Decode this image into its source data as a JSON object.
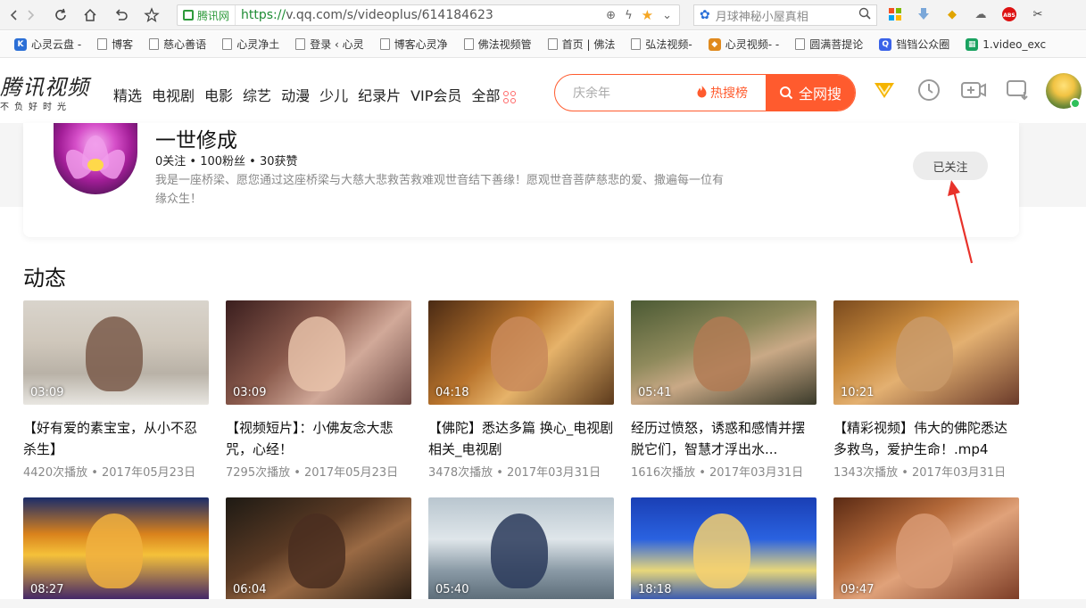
{
  "browser": {
    "site_badge": "腾讯网",
    "url_proto": "https://",
    "url_rest": "v.qq.com/s/videoplus/614184623",
    "side_search_text": "月球神秘小屋真相",
    "bookmarks": [
      {
        "label": "心灵云盘 -",
        "type": "fav",
        "color": "#2b6fd6",
        "glyph": "K"
      },
      {
        "label": "博客",
        "type": "doc"
      },
      {
        "label": "慈心善语",
        "type": "doc"
      },
      {
        "label": "心灵净土",
        "type": "doc"
      },
      {
        "label": "登录 ‹ 心灵",
        "type": "doc"
      },
      {
        "label": "博客心灵净",
        "type": "doc"
      },
      {
        "label": "佛法视频管",
        "type": "doc"
      },
      {
        "label": "首页 | 佛法",
        "type": "doc"
      },
      {
        "label": "弘法视频-",
        "type": "doc"
      },
      {
        "label": "心灵视频- -",
        "type": "fav",
        "color": "#e08a1e",
        "glyph": "◆"
      },
      {
        "label": "圆满菩提论",
        "type": "doc"
      },
      {
        "label": "铛铛公众圈",
        "type": "fav",
        "color": "#3a62e8",
        "glyph": "Q"
      },
      {
        "label": "1.video_exc",
        "type": "fav",
        "color": "#1aa260",
        "glyph": "▦"
      }
    ]
  },
  "header": {
    "logo_main": "腾讯视频",
    "logo_sub": "不负好时光",
    "nav": [
      "精选",
      "电视剧",
      "电影",
      "综艺",
      "动漫",
      "少儿",
      "纪录片",
      "VIP会员",
      "全部"
    ],
    "search_placeholder": "庆余年",
    "hot_label": "热搜榜",
    "search_button": "全网搜"
  },
  "profile": {
    "name": "一世修成",
    "stats": "0关注 • 100粉丝 • 30获赞",
    "description": "我是一座桥梁、愿您通过这座桥梁与大慈大悲救苦救难观世音结下善缘！愿观世音菩萨慈悲的爱、撒遍每一位有缘众生！",
    "follow_label": "已关注"
  },
  "section": {
    "title": "动态"
  },
  "videos": [
    {
      "duration": "03:09",
      "title": "【好有爱的素宝宝，从小不忍杀生】",
      "meta": "4420次播放 • 2017年05月23日"
    },
    {
      "duration": "03:09",
      "title": "【视频短片】：小佛友念大悲咒，心经！",
      "meta": "7295次播放 • 2017年05月23日"
    },
    {
      "duration": "04:18",
      "title": "【佛陀】悉达多篇 换心_电视剧相关_电视剧",
      "meta": "3478次播放 • 2017年03月31日"
    },
    {
      "duration": "05:41",
      "title": "经历过愤怒，诱惑和感情并摆脱它们，智慧才浮出水...",
      "meta": "1616次播放 • 2017年03月31日"
    },
    {
      "duration": "10:21",
      "title": "【精彩视频】伟大的佛陀悉达多救鸟，爱护生命！.mp4",
      "meta": "1343次播放 • 2017年03月31日"
    },
    {
      "duration": "08:27",
      "title": "",
      "meta": ""
    },
    {
      "duration": "06:04",
      "title": "",
      "meta": ""
    },
    {
      "duration": "05:40",
      "title": "",
      "meta": ""
    },
    {
      "duration": "18:18",
      "title": "",
      "meta": ""
    },
    {
      "duration": "09:47",
      "title": "",
      "meta": ""
    }
  ],
  "colors": {
    "accent": "#ff5b2e",
    "annotation_arrow": "#e8322a"
  }
}
